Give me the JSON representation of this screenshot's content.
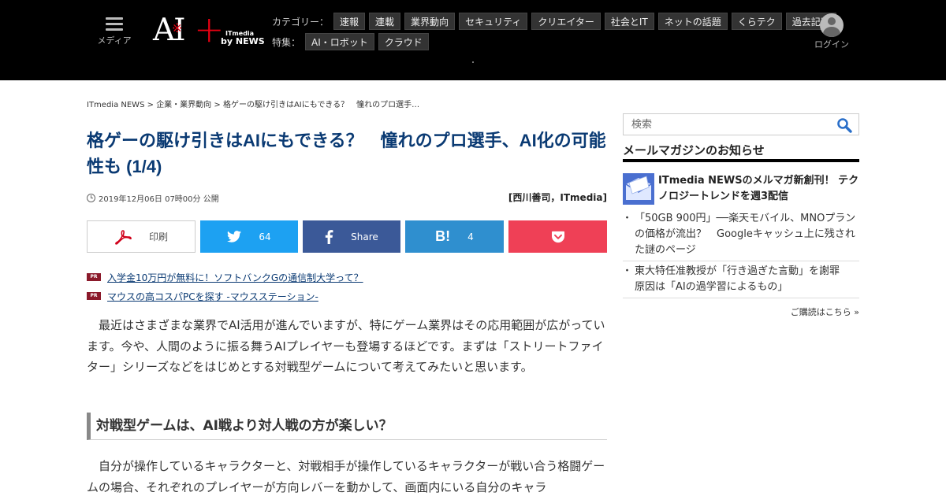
{
  "header": {
    "menu_label": "メディア",
    "logo": {
      "ai": "AI",
      "plus": "+",
      "sub": "ITmedia",
      "news": "by NEWS"
    },
    "category_label": "カテゴリー：",
    "categories": [
      "速報",
      "連載",
      "業界動向",
      "セキュリティ",
      "クリエイター",
      "社会とIT",
      "ネットの話題",
      "くらテク",
      "過去記事"
    ],
    "feature_label": "特集：",
    "features": [
      "AI・ロボット",
      "クラウド"
    ],
    "login_label": "ログイン"
  },
  "breadcrumb": {
    "items": [
      "ITmedia NEWS",
      "企業・業界動向",
      "格ゲーの駆け引きはAIにもできる？　憧れのプロ選手…"
    ],
    "separator": ">"
  },
  "article": {
    "title": "格ゲーの駆け引きはAIにもできる？　憧れのプロ選手、AI化の可能性も (1/4)",
    "published": "2019年12月06日 07時00分 公開",
    "author": "[西川善司，ITmedia]",
    "paragraph1": "最近はさまざまな業界でAI活用が進んでいますが、特にゲーム業界はその応用範囲が広がっています。今や、人間のように振る舞うAIプレイヤーも登場するほどです。まずは「ストリートファイター」シリーズなどをはじめとする対戦型ゲームについて考えてみたいと思います。",
    "subheading": "対戦型ゲームは、AI戦より対人戦の方が楽しい？",
    "paragraph2": "自分が操作しているキャラクターと、対戦相手が操作しているキャラクターが戦い合う格闘ゲームの場合、それぞれのプレイヤーが方向レバーを動かして、画面内にいる自分のキャラ"
  },
  "share": {
    "print_label": "印刷",
    "twitter_count": "64",
    "facebook_label": "Share",
    "hatena_count": "4"
  },
  "pr": {
    "badge": "PR",
    "links": [
      "入学金10万円が無料に！ソフトバンクGの通信制大学って？",
      "マウスの高コスパPCを探す -マウスステーション-"
    ]
  },
  "sidebar": {
    "search_placeholder": "検索",
    "mm_heading": "メールマガジンのお知らせ",
    "mm_feature": "ITmedia NEWSのメルマガ新創刊！ テクノロジートレンドを週3配信",
    "mm_items": [
      "「50GB 900円」──楽天モバイル、MNOプランの価格が流出？　Googleキャッシュ上に残された謎のページ",
      "東大特任准教授が「行き過ぎた言動」を謝罪　原因は「AIの過学習によるもの」"
    ],
    "mm_more": "ご購読はこちら »"
  },
  "colors": {
    "title_blue": "#0a3a73",
    "twitter": "#1da1f2",
    "facebook": "#3b5998",
    "hatena": "#2f8fcf",
    "pocket": "#ef4056",
    "pr_badge": "#8b1a2b",
    "logo_red": "#e60012"
  },
  "icons": [
    "menu-icon",
    "user-avatar-icon",
    "clock-icon",
    "pdf-icon",
    "twitter-icon",
    "facebook-icon",
    "hatena-icon",
    "pocket-icon",
    "search-icon",
    "mail-icon"
  ]
}
